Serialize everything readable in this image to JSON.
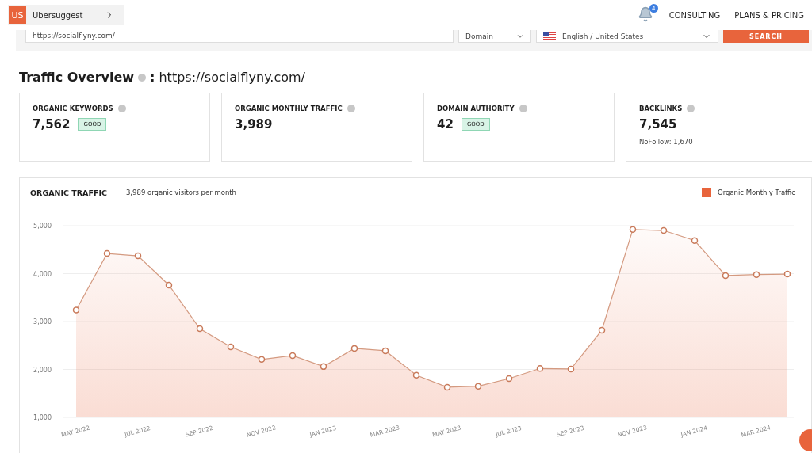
{
  "header": {
    "logo": "US",
    "product": "Ubersuggest",
    "notifications": "4",
    "nav": [
      "CONSULTING",
      "PLANS & PRICING"
    ]
  },
  "search": {
    "value": "https://socialflyny.com/",
    "mode": "Domain",
    "locale": "English / United States",
    "button": "SEARCH"
  },
  "overview": {
    "title": "Traffic Overview",
    "separator": ":",
    "domain": "https://socialflyny.com/"
  },
  "metrics": [
    {
      "label": "ORGANIC KEYWORDS",
      "value": "7,562",
      "badge": "GOOD"
    },
    {
      "label": "ORGANIC MONTHLY TRAFFIC",
      "value": "3,989"
    },
    {
      "label": "DOMAIN AUTHORITY",
      "value": "42",
      "badge": "GOOD"
    },
    {
      "label": "BACKLINKS",
      "value": "7,545",
      "note": "NoFollow: 1,670"
    }
  ],
  "traffic": {
    "title": "ORGANIC TRAFFIC",
    "subtitle": "3,989 organic visitors per month",
    "chart_data": {
      "type": "area",
      "categories": [
        "MAY 2022",
        null,
        "JUL 2022",
        null,
        "SEP 2022",
        null,
        "NOV 2022",
        null,
        "JAN 2023",
        null,
        "MAR 2023",
        null,
        "MAY 2023",
        null,
        "JUL 2023",
        null,
        "SEP 2023",
        null,
        "NOV 2023",
        null,
        "JAN 2024",
        null,
        "MAR 2024",
        null
      ],
      "series": [
        {
          "name": "Organic Monthly Traffic",
          "color": "#e8643c",
          "values": [
            3240,
            4420,
            4370,
            3760,
            2850,
            2470,
            2210,
            2290,
            2060,
            2440,
            2390,
            1880,
            1630,
            1650,
            1810,
            2020,
            2010,
            2820,
            4920,
            4900,
            4690,
            3960,
            3980,
            3990
          ]
        }
      ],
      "ylim": [
        1000,
        5000
      ],
      "grid": true,
      "yticks": [
        {
          "value": 1000,
          "label": "1,000"
        },
        {
          "value": 2000,
          "label": "2,000"
        },
        {
          "value": 3000,
          "label": "3,000"
        },
        {
          "value": 4000,
          "label": "4,000"
        },
        {
          "value": 5000,
          "label": "5,000"
        }
      ]
    }
  }
}
